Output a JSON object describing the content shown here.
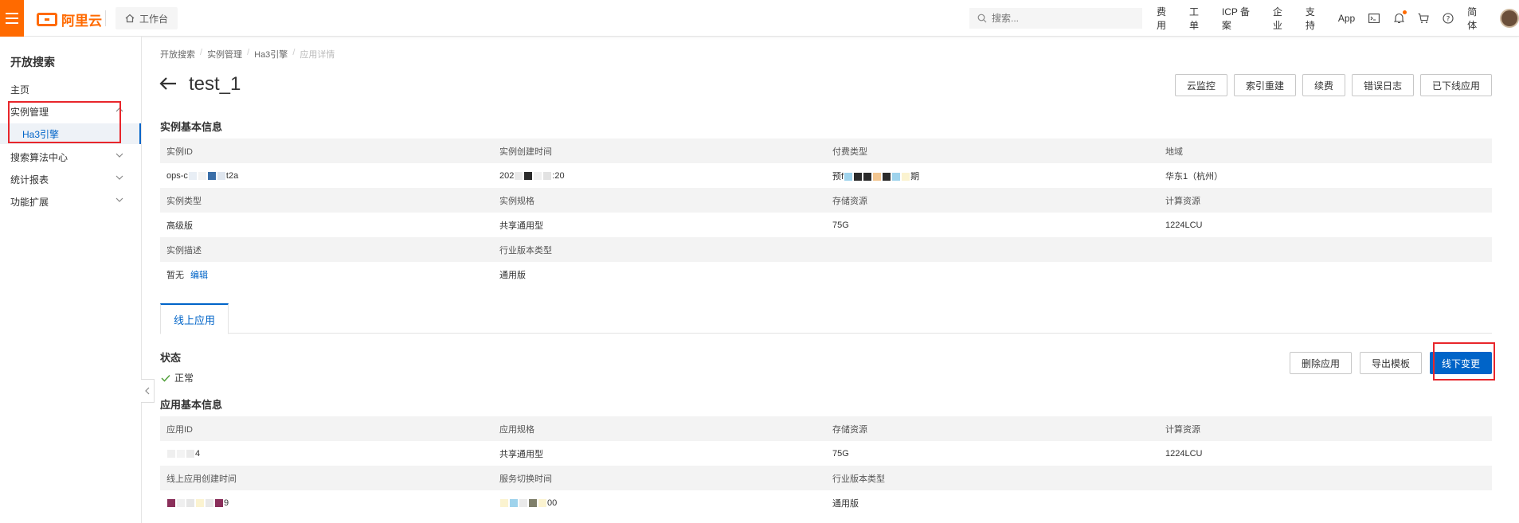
{
  "topbar": {
    "brand": "阿里云",
    "workbench": "工作台",
    "search_placeholder": "搜索...",
    "nav": [
      "费用",
      "工单",
      "ICP 备案",
      "企业",
      "支持",
      "App"
    ],
    "lang": "简体",
    "icons": [
      "terminal-icon",
      "bell-icon",
      "cart-icon",
      "help-icon"
    ]
  },
  "sidebar": {
    "title": "开放搜索",
    "items": [
      {
        "label": "主页"
      },
      {
        "label": "实例管理"
      },
      {
        "label": "Ha3引擎"
      },
      {
        "label": "搜索算法中心"
      },
      {
        "label": "统计报表"
      },
      {
        "label": "功能扩展"
      }
    ]
  },
  "breadcrumb": [
    "开放搜索",
    "实例管理",
    "Ha3引擎",
    "应用详情"
  ],
  "page": {
    "title": "test_1",
    "actions": [
      "云监控",
      "索引重建",
      "续费",
      "错误日志",
      "已下线应用"
    ]
  },
  "instance_info": {
    "title": "实例基本信息",
    "rows": [
      {
        "heads": [
          "实例ID",
          "实例创建时间",
          "付费类型",
          "地域"
        ],
        "values": [
          "ops-c",
          "202",
          "预f",
          "华东1（杭州）"
        ],
        "suffixes": [
          "t2a",
          ":20",
          "期",
          ""
        ]
      },
      {
        "heads": [
          "实例类型",
          "实例规格",
          "存储资源",
          "计算资源"
        ],
        "values": [
          "高级版",
          "共享通用型",
          "75G",
          "1224LCU"
        ]
      },
      {
        "heads": [
          "实例描述",
          "行业版本类型",
          "",
          ""
        ],
        "values": [
          "暂无",
          "通用版",
          "",
          ""
        ]
      }
    ],
    "edit_link": "编辑"
  },
  "tabs": [
    "线上应用"
  ],
  "status": {
    "title": "状态",
    "value": "正常",
    "color": "#52a03c"
  },
  "app_actions": [
    "删除应用",
    "导出模板",
    "线下变更"
  ],
  "app_info": {
    "title": "应用基本信息",
    "rows": [
      {
        "heads": [
          "应用ID",
          "应用规格",
          "存储资源",
          "计算资源"
        ],
        "values": [
          "4",
          "共享通用型",
          "75G",
          "1224LCU"
        ]
      },
      {
        "heads": [
          "线上应用创建时间",
          "服务切换时间",
          "行业版本类型",
          ""
        ],
        "values": [
          "9",
          "00",
          "通用版",
          ""
        ]
      }
    ]
  },
  "colors": {
    "accent": "#ff6a00",
    "primary": "#0064c8",
    "highlight": "#e8262b"
  }
}
